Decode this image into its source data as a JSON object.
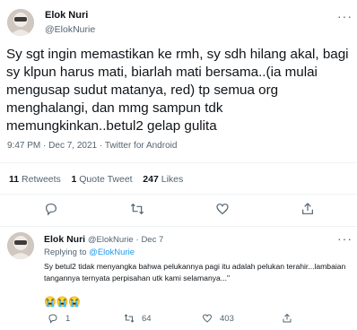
{
  "main_tweet": {
    "author_name": "Elok Nuri",
    "author_handle": "@ElokNurie",
    "more_label": "···",
    "text": "Sy sgt ingin memastikan ke rmh, sy sdh hilang akal, bagi sy klpun harus mati, biarlah mati bersama..(ia mulai mengusap sudut matanya, red) tp semua org menghalangi, dan mmg  sampun tdk memungkinkan..betul2 gelap gulita",
    "time": "9:47 PM",
    "date": "Dec 7, 2021",
    "separator": "·",
    "source": "Twitter for Android",
    "retweets_count": "11",
    "retweets_label": "Retweets",
    "quotes_count": "1",
    "quotes_label": "Quote Tweet",
    "likes_count": "247",
    "likes_label": "Likes"
  },
  "reply": {
    "author_name": "Elok Nuri",
    "author_handle": "@ElokNurie",
    "date": "Dec 7",
    "separator": "·",
    "replying_prefix": "Replying to",
    "replying_handle": "@ElokNurie",
    "text": "Sy betul2 tidak menyangka bahwa pelukannya pagi itu adalah pelukan terahir...lambaian tangannya ternyata perpisahan utk kami selamanya...\"",
    "emojis": "😭😭😭",
    "reply_count": "1",
    "retweet_count": "64",
    "like_count": "403",
    "more_label": "···"
  },
  "icons": [
    "reply-icon",
    "retweet-icon",
    "like-icon",
    "share-icon"
  ],
  "colors": {
    "text": "#0f1419",
    "muted": "#536471",
    "link": "#1d9bf0",
    "divider": "#eff3f4"
  }
}
